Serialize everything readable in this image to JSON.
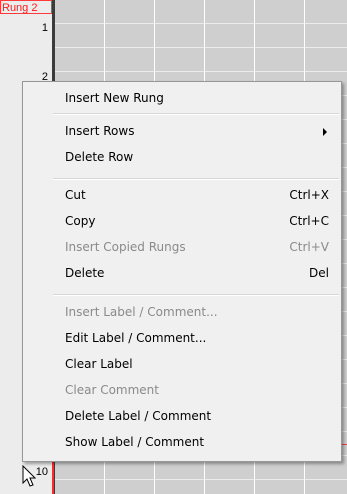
{
  "editor": {
    "rung_label": "Rung 2",
    "row_numbers": [
      "1",
      "2",
      "10"
    ]
  },
  "menu": {
    "items": [
      {
        "label": "Insert New Rung",
        "shortcut": "",
        "enabled": true
      },
      {
        "label": "Insert Rows",
        "shortcut": "",
        "enabled": true,
        "submenu": true
      },
      {
        "label": "Delete Row",
        "shortcut": "",
        "enabled": true
      },
      {
        "label": "Cut",
        "shortcut": "Ctrl+X",
        "enabled": true
      },
      {
        "label": "Copy",
        "shortcut": "Ctrl+C",
        "enabled": true
      },
      {
        "label": "Insert Copied Rungs",
        "shortcut": "Ctrl+V",
        "enabled": false
      },
      {
        "label": "Delete",
        "shortcut": "Del",
        "enabled": true
      },
      {
        "label": "Insert Label / Comment...",
        "shortcut": "",
        "enabled": false
      },
      {
        "label": "Edit Label / Comment...",
        "shortcut": "",
        "enabled": true
      },
      {
        "label": "Clear Label",
        "shortcut": "",
        "enabled": true
      },
      {
        "label": "Clear Comment",
        "shortcut": "",
        "enabled": false
      },
      {
        "label": "Delete Label / Comment",
        "shortcut": "",
        "enabled": true
      },
      {
        "label": "Show Label / Comment",
        "shortcut": "",
        "enabled": true
      }
    ]
  },
  "icons": {
    "submenu_arrow": "chevron-right-icon",
    "cursor": "mouse-pointer-icon"
  },
  "colors": {
    "rung_label": "#ff1a1a",
    "disabled_text": "#8a8a8a",
    "menu_bg": "#f0f0f0"
  }
}
